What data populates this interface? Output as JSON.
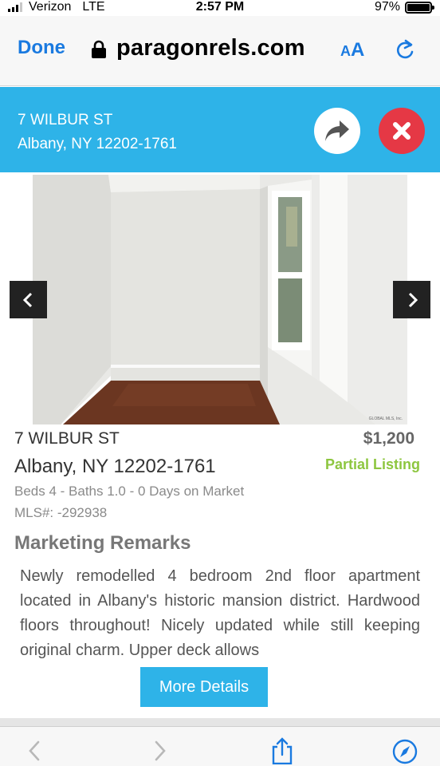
{
  "status_bar": {
    "carrier": "Verizon",
    "network": "LTE",
    "time": "2:57 PM",
    "battery": "97%"
  },
  "browser": {
    "done_label": "Done",
    "url": "paragonrels.com",
    "text_size_small": "A",
    "text_size_large": "A"
  },
  "header": {
    "street": "7 WILBUR ST",
    "city": "Albany, NY 12202-1761",
    "share_icon": "share-arrow-icon",
    "close_icon": "close-icon"
  },
  "photo": {
    "watermark": "GLOBAL MLS, Inc."
  },
  "listing": {
    "street": "7 WILBUR ST",
    "city": "Albany, NY 12202-1761",
    "price": "$1,200",
    "status": "Partial Listing",
    "meta": "Beds 4 - Baths 1.0 - 0 Days on Market",
    "mls": "MLS#: -292938",
    "remarks_heading": "Marketing Remarks",
    "remarks": "Newly remodelled 4 bedroom 2nd floor apartment located in Albany's historic mansion district. Hardwood floors throughout! Nicely updated while still keeping original charm. Upper deck allows",
    "more_button": "More Details"
  },
  "colors": {
    "header_blue": "#2eb3e8",
    "close_red": "#e53845",
    "partial_green": "#8dc63f",
    "link_blue": "#1a7ae0"
  }
}
